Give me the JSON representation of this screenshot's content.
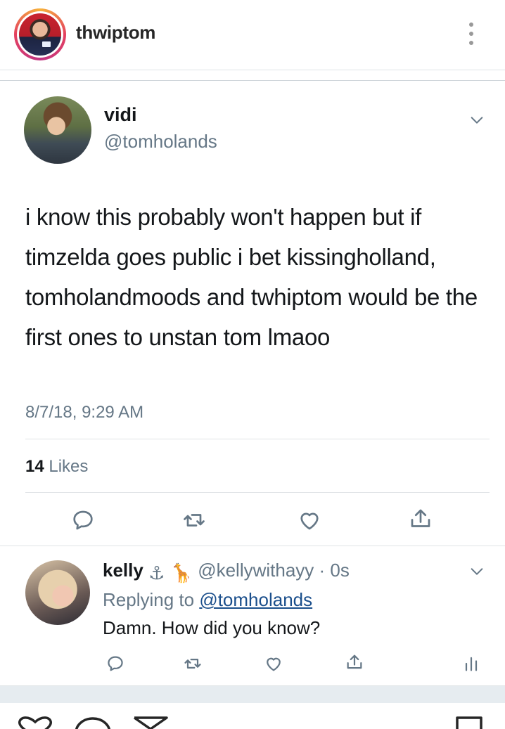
{
  "post": {
    "username": "thwiptom"
  },
  "tweet": {
    "display_name": "vidi",
    "handle": "@tomholands",
    "text": "i know this probably won't happen but if timzelda goes public i bet kissingholland, tomholandmoods and twhiptom would be the first ones to unstan tom lmaoo",
    "timestamp": "8/7/18, 9:29 AM",
    "likes_count": "14",
    "likes_label": "Likes"
  },
  "reply": {
    "display_name": "kelly",
    "emojis": "⚓ 🦒",
    "handle": "@kellywithayy",
    "age": "· 0s",
    "replying_prefix": "Replying to",
    "replying_to": "@tomholands",
    "text": "Damn. How did you know?"
  },
  "colors": {
    "text": "#14171a",
    "muted": "#657786",
    "link": "#1b4f8c",
    "divider": "#dfe3e6"
  },
  "icons": [
    "more-vertical-icon",
    "chevron-down-icon",
    "reply-icon",
    "retweet-icon",
    "heart-icon",
    "share-icon",
    "analytics-icon",
    "heart-outline-icon",
    "comment-icon",
    "send-icon",
    "bookmark-icon"
  ]
}
